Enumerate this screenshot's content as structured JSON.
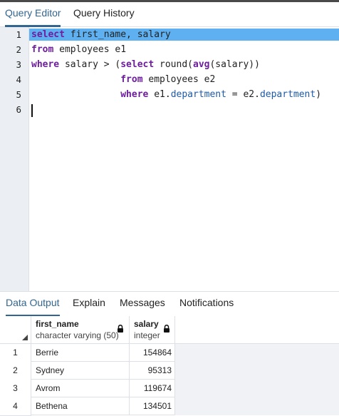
{
  "editor_tabs": [
    "Query Editor",
    "Query History"
  ],
  "line_numbers": [
    "1",
    "2",
    "3",
    "4",
    "5",
    "6"
  ],
  "sql": {
    "line1": {
      "kw": "select",
      "rest": " first_name, salary"
    },
    "line2": {
      "kw": "from",
      "rest": " employees e1"
    },
    "line3": {
      "kw": "where",
      "a": " salary > (",
      "kw2": "select",
      "b": " round(",
      "kw3": "avg",
      "c": "(salary))"
    },
    "line4": {
      "indent": "                ",
      "kw": "from",
      "rest": " employees e2"
    },
    "line5": {
      "indent": "                ",
      "kw": "where",
      "a": " e1.",
      "col1": "department",
      "b": " = e2.",
      "col2": "department",
      "c": ")"
    },
    "line6": ""
  },
  "output_tabs": [
    "Data Output",
    "Explain",
    "Messages",
    "Notifications"
  ],
  "grid": {
    "columns": [
      {
        "name": "first_name",
        "type": "character varying (50)"
      },
      {
        "name": "salary",
        "type": "integer"
      }
    ],
    "rows": [
      {
        "num": "1",
        "first_name": "Berrie",
        "salary": "154864"
      },
      {
        "num": "2",
        "first_name": "Sydney",
        "salary": "95313"
      },
      {
        "num": "3",
        "first_name": "Avrom",
        "salary": "119674"
      },
      {
        "num": "4",
        "first_name": "Bethena",
        "salary": "134501"
      }
    ]
  },
  "colors": {
    "accent": "#326690",
    "selection": "#5eb0f0",
    "keyword": "#6d1d9e",
    "identifier": "#1d5aa8"
  },
  "icons": [
    "lock-icon",
    "select-all-corner-icon"
  ]
}
